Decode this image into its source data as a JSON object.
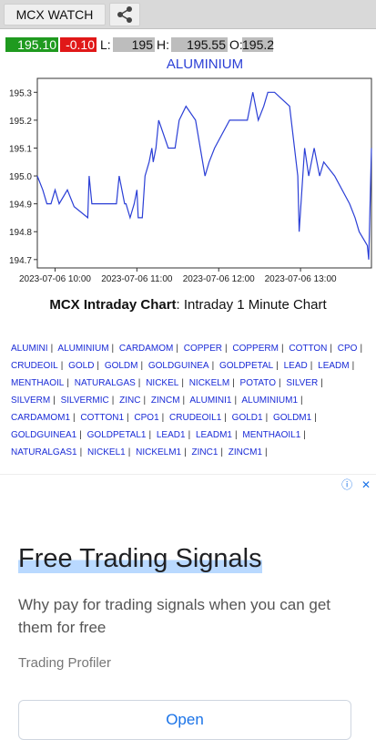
{
  "app": {
    "title": "MCX WATCH"
  },
  "quote": {
    "ltp": "195.10",
    "change": "-0.10",
    "low_label": "L:",
    "low": "195",
    "high_label": "H:",
    "high": "195.55",
    "open_label": "O:",
    "open": "195.2",
    "ltp_color": "#1f9a1f",
    "change_color": "#e01818"
  },
  "chart_data": {
    "type": "line",
    "title": "ALUMINIUM",
    "line_color": "#2b3fd6",
    "ylim": [
      194.67,
      195.35
    ],
    "y_ticks": [
      "195.3",
      "195.2",
      "195.1",
      "195.0",
      "194.9",
      "194.8",
      "194.7"
    ],
    "y_tick_values": [
      195.3,
      195.2,
      195.1,
      195.0,
      194.9,
      194.8,
      194.7
    ],
    "x_ticks": [
      "2023-07-06 10:00",
      "2023-07-06 11:00",
      "2023-07-06 12:00",
      "2023-07-06 13:00"
    ],
    "x_tick_minutes": [
      0,
      60,
      120,
      180
    ],
    "x_start": "2023-07-06 09:47",
    "x_end": "2023-07-06 13:52",
    "series": [
      {
        "name": "",
        "x": [
          "09:47",
          "09:51",
          "09:54",
          "09:57",
          "10:00",
          "10:03",
          "10:09",
          "10:14",
          "10:24",
          "10:25",
          "10:27",
          "10:33",
          "10:35",
          "10:39",
          "10:45",
          "10:47",
          "10:51",
          "10:52",
          "10:55",
          "10:58",
          "11:00",
          "11:01",
          "11:04",
          "11:06",
          "11:09",
          "11:11",
          "11:12",
          "11:14",
          "11:16",
          "11:23",
          "11:28",
          "11:31",
          "11:36",
          "11:43",
          "11:50",
          "11:53",
          "11:57",
          "12:08",
          "12:13",
          "12:19",
          "12:21",
          "12:23",
          "12:25",
          "12:29",
          "12:33",
          "12:36",
          "12:41",
          "12:52",
          "12:58",
          "12:59",
          "13:03",
          "13:06",
          "13:08",
          "13:10",
          "13:14",
          "13:17",
          "13:25",
          "13:36",
          "13:40",
          "13:43",
          "13:49",
          "13:50",
          "13:52"
        ],
        "y": [
          195.0,
          194.95,
          194.9,
          194.9,
          194.95,
          194.9,
          194.95,
          194.89,
          194.85,
          195.0,
          194.9,
          194.9,
          194.9,
          194.9,
          194.9,
          195.0,
          194.9,
          194.9,
          194.85,
          194.9,
          194.95,
          194.85,
          194.85,
          195.0,
          195.05,
          195.1,
          195.05,
          195.1,
          195.2,
          195.1,
          195.1,
          195.2,
          195.25,
          195.2,
          195.0,
          195.05,
          195.1,
          195.2,
          195.2,
          195.2,
          195.2,
          195.25,
          195.3,
          195.2,
          195.25,
          195.3,
          195.3,
          195.25,
          195.0,
          194.8,
          195.1,
          195.0,
          195.05,
          195.1,
          195.0,
          195.05,
          195.0,
          194.9,
          194.85,
          194.8,
          194.75,
          194.7,
          195.1
        ]
      }
    ]
  },
  "caption": {
    "bold": "MCX Intraday Chart",
    "rest": ": Intraday 1 Minute Chart"
  },
  "symbols": [
    "ALUMINI",
    "ALUMINIUM",
    "CARDAMOM",
    "COPPER",
    "COPPERM",
    "COTTON",
    "CPO",
    "CRUDEOIL",
    "GOLD",
    "GOLDM",
    "GOLDGUINEA",
    "GOLDPETAL",
    "LEAD",
    "LEADM",
    "MENTHAOIL",
    "NATURALGAS",
    "NICKEL",
    "NICKELM",
    "POTATO",
    "SILVER",
    "SILVERM",
    "SILVERMIC",
    "ZINC",
    "ZINCM",
    "ALUMINI1",
    "ALUMINIUM1",
    "CARDAMOM1",
    "COTTON1",
    "CPO1",
    "CRUDEOIL1",
    "GOLD1",
    "GOLDM1",
    "GOLDGUINEA1",
    "GOLDPETAL1",
    "LEAD1",
    "LEADM1",
    "MENTHAOIL1",
    "NATURALGAS1",
    "NICKEL1",
    "NICKELM1",
    "ZINC1",
    "ZINCM1"
  ],
  "ad": {
    "headline": "Free Trading Signals",
    "body": "Why pay for trading signals when you can get them for free",
    "brand": "Trading Profiler",
    "cta": "Open",
    "info_icon": "info-icon",
    "close_icon": "close-icon"
  }
}
